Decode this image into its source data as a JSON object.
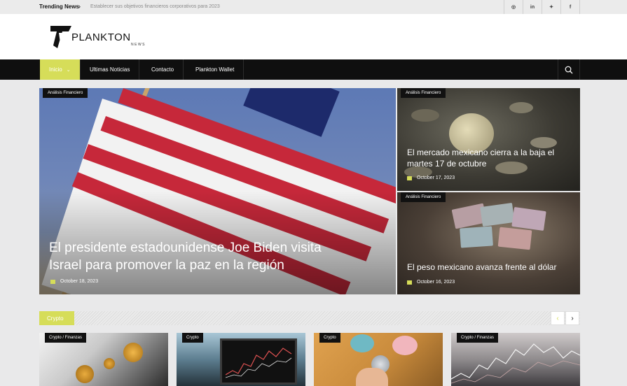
{
  "topbar": {
    "trending_label": "Trending News",
    "trending_arrow": "›",
    "trending_text": "Establecer sus objetivos financieros corporativos para 2023",
    "social": [
      {
        "icon": "instagram-icon",
        "glyph": "◎"
      },
      {
        "icon": "linkedin-icon",
        "glyph": "in"
      },
      {
        "icon": "twitter-icon",
        "glyph": "✦"
      },
      {
        "icon": "facebook-icon",
        "glyph": "f"
      }
    ]
  },
  "brand": {
    "name": "PLANKTON",
    "sub": "NEWS"
  },
  "nav": {
    "items": [
      {
        "label": "Inicio",
        "active": true
      },
      {
        "label": "Ultimas Noticias"
      },
      {
        "label": "Contacto"
      },
      {
        "label": "Plankton Wallet"
      }
    ],
    "chevron": "⌄",
    "search_icon": "search-icon"
  },
  "hero": {
    "main": {
      "tag": "Análisis Financiero",
      "title_line1": "El presidente estadounidense Joe Biden visita",
      "title_line2": "Israel para promover la paz en la región",
      "date": "October 18, 2023"
    },
    "side": [
      {
        "tag": "Análisis Financiero",
        "title_line1": "El mercado mexicano cierra a la baja el",
        "title_line2": "martes 17 de octubre",
        "date": "October 17, 2023"
      },
      {
        "tag": "Análisis Financiero",
        "title_line1": "El peso mexicano avanza frente al dólar",
        "date": "October 16, 2023"
      }
    ]
  },
  "crypto": {
    "label": "Crypto",
    "prev": "‹",
    "next": "›",
    "cards": [
      {
        "tag": "Crypto / Finanzas"
      },
      {
        "tag": "Crypto"
      },
      {
        "tag": "Crypto"
      },
      {
        "tag": "Crypto / Finanzas"
      }
    ]
  },
  "colors": {
    "accent": "#d6dd59",
    "nav_bg": "#0f0f0f",
    "page_bg": "#e9e9ea"
  }
}
